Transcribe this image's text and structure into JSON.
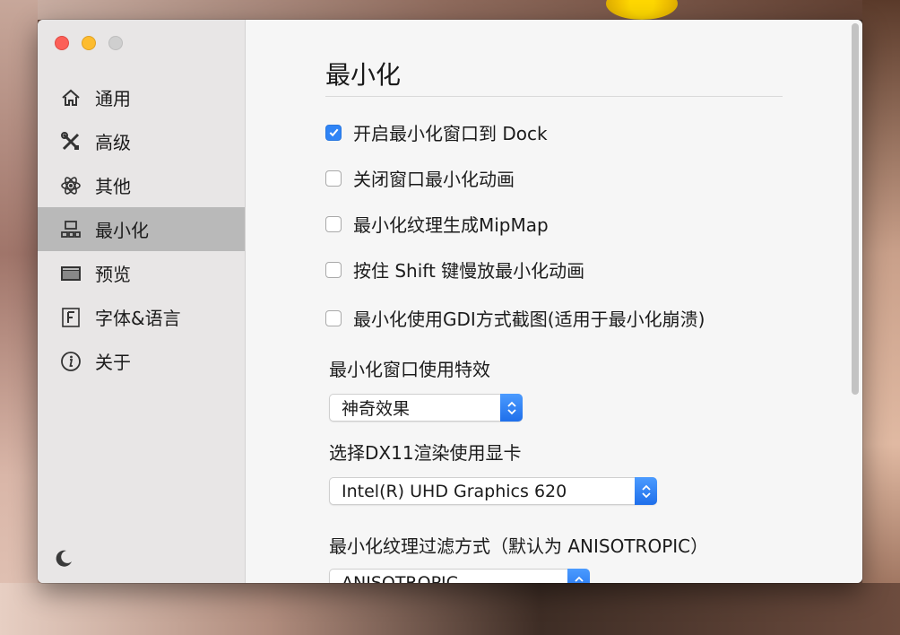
{
  "sidebar": {
    "items": [
      {
        "label": "通用",
        "icon": "home-icon"
      },
      {
        "label": "高级",
        "icon": "tools-icon"
      },
      {
        "label": "其他",
        "icon": "atom-icon"
      },
      {
        "label": "最小化",
        "icon": "minimize-icon"
      },
      {
        "label": "预览",
        "icon": "preview-icon"
      },
      {
        "label": "字体&语言",
        "icon": "font-icon"
      },
      {
        "label": "关于",
        "icon": "info-icon"
      }
    ],
    "active_index": 3,
    "footer_icon": "moon-icon"
  },
  "main": {
    "title": "最小化",
    "checkboxes": [
      {
        "label": "开启最小化窗口到 Dock",
        "checked": true
      },
      {
        "label": "关闭窗口最小化动画",
        "checked": false
      },
      {
        "label": "最小化纹理生成MipMap",
        "checked": false
      },
      {
        "label": "按住 Shift 键慢放最小化动画",
        "checked": false
      },
      {
        "label": "最小化使用GDI方式截图(适用于最小化崩溃)",
        "checked": false
      }
    ],
    "effect_label": "最小化窗口使用特效",
    "effect_value": "神奇效果",
    "gpu_label": "选择DX11渲染使用显卡",
    "gpu_value": "Intel(R) UHD Graphics 620",
    "filter_label": "最小化纹理过滤方式（默认为 ANISOTROPIC）",
    "filter_value": "ANISOTROPIC"
  },
  "colors": {
    "accent": "#2f84f6",
    "sidebar_bg": "#e8e6e6",
    "active_bg": "#b9b9b9",
    "close": "#fc5f57",
    "minimize": "#fdbc2e",
    "zoom": "#cfcfcf"
  }
}
